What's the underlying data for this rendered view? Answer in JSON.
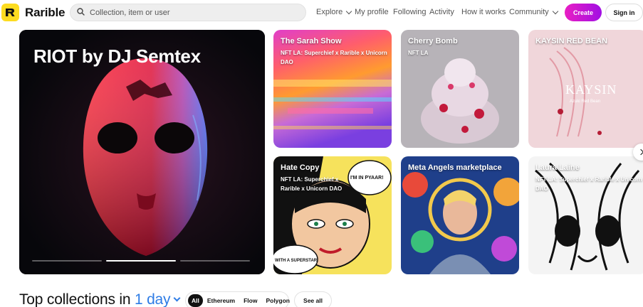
{
  "header": {
    "brand": "Rarible",
    "search_placeholder": "Collection, item or user",
    "nav": {
      "explore": "Explore",
      "my_profile": "My profile",
      "following": "Following",
      "activity": "Activity",
      "how_it_works": "How it works",
      "community": "Community"
    },
    "create_label": "Create",
    "signin_label": "Sign in"
  },
  "hero": {
    "title": "RIOT by DJ Semtex",
    "slides": 3,
    "active_slide": 2
  },
  "cards": [
    {
      "title": "The Sarah Show",
      "subtitle": "NFT LA: Superchief x Rarible x Unicorn DAO"
    },
    {
      "title": "Cherry Bomb",
      "subtitle": "NFT LA"
    },
    {
      "title": "KAYSIN RED BEAN",
      "subtitle": ""
    },
    {
      "title": "Hate Copy",
      "subtitle": "NFT LA: Superchief x Rarible x Unicorn DAO"
    },
    {
      "title": "Meta Angels marketplace",
      "subtitle": ""
    },
    {
      "title": "Laura Laine",
      "subtitle": "NFT LA: Superchief x Rarible x Unicorn DAO"
    }
  ],
  "artwork_text": {
    "kaysin": "KAYSIN",
    "kaysin_small": "Azuki Red Bean",
    "hate_copy_bubble_1": "I'M IN PYAAR!",
    "hate_copy_bubble_2": "WITH A SUPERSTAR!"
  },
  "top_collections": {
    "title_prefix": "Top collections in",
    "period": "1 day",
    "chains": [
      "All",
      "Ethereum",
      "Flow",
      "Polygon"
    ],
    "active_chain": "All",
    "see_all_label": "See all"
  },
  "colors": {
    "logo_yellow": "#fddc20",
    "create_gradient_start": "#e91ec4",
    "create_gradient_end": "#a10fe3",
    "period_blue": "#2e7ce5"
  },
  "icons": [
    "rarible-logo-icon",
    "search-icon",
    "chevron-down-icon",
    "chevron-right-icon"
  ]
}
